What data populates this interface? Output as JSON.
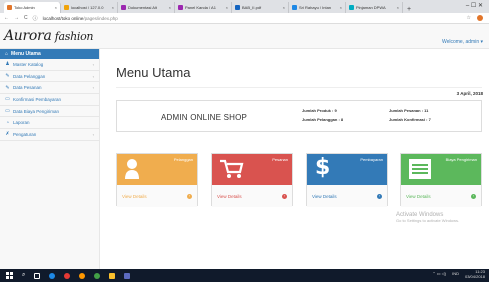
{
  "browser": {
    "tabs": [
      {
        "label": "Toko Admin",
        "color": "#e2752a",
        "active": true
      },
      {
        "label": "localhost / 127.0.0",
        "color": "#f0a30a",
        "active": false
      },
      {
        "label": "Dokumentasi Alt",
        "color": "#9c27b0",
        "active": false
      },
      {
        "label": "Panel Kanda / A1",
        "color": "#9c27b0",
        "active": false
      },
      {
        "label": "BAB_II.pdf",
        "color": "#1565c0",
        "active": false
      },
      {
        "label": "Sri Rahayu / Intan",
        "color": "#1e88e5",
        "active": false
      },
      {
        "label": "Pinjaman DPWA",
        "color": "#00acc1",
        "active": false
      }
    ],
    "new_tab": "+",
    "back": "←",
    "forward": "→",
    "reload": "C",
    "url_host": "localhost/toko online",
    "url_path": "/pages/index.php",
    "star": "☆"
  },
  "app": {
    "logo_main": "Aurora",
    "logo_sub": "fashion",
    "welcome": "Welcome, admin ▾"
  },
  "sidebar": {
    "header": "Menu Utama",
    "items": [
      {
        "label": "Master Katalog",
        "icon": "users-icon",
        "glyph": "♟",
        "chevron": "‹"
      },
      {
        "label": "Data Pelanggan",
        "icon": "edit-icon",
        "glyph": "✎",
        "chevron": "‹"
      },
      {
        "label": "Data Pesanan",
        "icon": "edit-icon",
        "glyph": "✎",
        "chevron": "‹"
      },
      {
        "label": "Konfirmasi Pembayaran",
        "icon": "card-icon",
        "glyph": "▭",
        "chevron": ""
      },
      {
        "label": "Data Biaya Pengiriman",
        "icon": "card-icon",
        "glyph": "▭",
        "chevron": ""
      },
      {
        "label": "Laporan",
        "icon": "chart-icon",
        "glyph": "◔",
        "chevron": ""
      },
      {
        "label": "Pengaturan",
        "icon": "wrench-icon",
        "glyph": "✗",
        "chevron": "‹"
      }
    ]
  },
  "main": {
    "title": "Menu Utama",
    "date": "3 April, 2018",
    "shop_name": "ADMIN ONLINE SHOP",
    "stats": {
      "produk": "Jumlah Produk : 9",
      "pelanggan": "Jumlah Pelanggan : 8",
      "pesanan": "Jumlah Pesanan : 11",
      "konfirmasi": "Jumlah Konfirmasi : 7"
    },
    "cards": [
      {
        "label": "Pelanggan",
        "link": "View Details",
        "color": "#f0ad4e",
        "icon": "user-icon"
      },
      {
        "label": "Pesanan",
        "link": "View Details",
        "color": "#d9534f",
        "icon": "cart-icon"
      },
      {
        "label": "Pembayaran",
        "link": "View Details",
        "color": "#337ab7",
        "icon": "dollar-icon"
      },
      {
        "label": "Biaya Pengiriman",
        "link": "View Details",
        "color": "#5cb85c",
        "icon": "list-icon"
      }
    ],
    "watermark": {
      "line1": "Activate Windows",
      "line2": "Go to Settings to activate Windows."
    }
  },
  "taskbar": {
    "time": "11:23",
    "date": "03/04/2018",
    "lang": "IND"
  }
}
